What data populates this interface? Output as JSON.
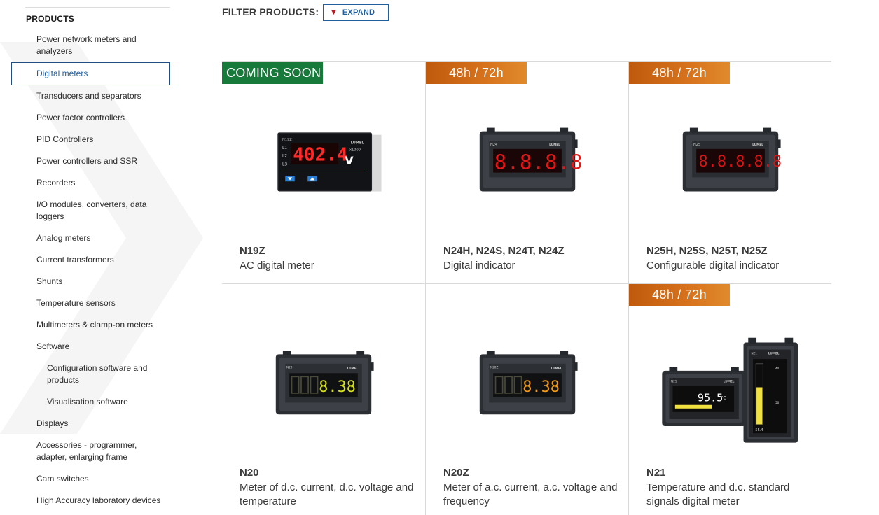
{
  "sidebar": {
    "heading": "PRODUCTS",
    "items": [
      {
        "label": "Power network meters and analyzers",
        "sub": false,
        "active": false
      },
      {
        "label": "Digital meters",
        "sub": false,
        "active": true
      },
      {
        "label": "Transducers and separators",
        "sub": false,
        "active": false
      },
      {
        "label": "Power factor controllers",
        "sub": false,
        "active": false
      },
      {
        "label": "PID Controllers",
        "sub": false,
        "active": false
      },
      {
        "label": "Power controllers and SSR",
        "sub": false,
        "active": false
      },
      {
        "label": "Recorders",
        "sub": false,
        "active": false
      },
      {
        "label": "I/O modules, converters, data loggers",
        "sub": false,
        "active": false
      },
      {
        "label": "Analog meters",
        "sub": false,
        "active": false
      },
      {
        "label": "Current transformers",
        "sub": false,
        "active": false
      },
      {
        "label": "Shunts",
        "sub": false,
        "active": false
      },
      {
        "label": "Temperature sensors",
        "sub": false,
        "active": false
      },
      {
        "label": "Multimeters & clamp-on meters",
        "sub": false,
        "active": false
      },
      {
        "label": "Software",
        "sub": false,
        "active": false
      },
      {
        "label": "Configuration software and products",
        "sub": true,
        "active": false
      },
      {
        "label": "Visualisation software",
        "sub": true,
        "active": false
      },
      {
        "label": "Displays",
        "sub": false,
        "active": false
      },
      {
        "label": "Accessories - programmer, adapter, enlarging frame",
        "sub": false,
        "active": false
      },
      {
        "label": "Cam switches",
        "sub": false,
        "active": false
      },
      {
        "label": "High Accuracy laboratory devices",
        "sub": false,
        "active": false
      }
    ]
  },
  "filter": {
    "label": "FILTER PRODUCTS:",
    "expand_label": "EXPAND",
    "expand_icon": "triangle-down-icon"
  },
  "colors": {
    "accent_blue": "#1f5f9e",
    "badge_green": "#177a3a",
    "badge_orange": "#d7731d",
    "expand_arrow": "#b01e23"
  },
  "products": [
    {
      "code": "N19Z",
      "desc": "AC digital meter",
      "badge": "COMING SOON",
      "badge_style": "green",
      "display_digits": "402.4",
      "display_color": "#ff2a2a",
      "panel_labels": [
        "N19Z",
        "L1",
        "L2",
        "L3",
        "LUMEL",
        "x1000",
        "V"
      ]
    },
    {
      "code": "N24H, N24S, N24T, N24Z",
      "desc": "Digital indicator",
      "badge": "48h / 72h",
      "badge_style": "orange",
      "display_digits": "8.8.8.8",
      "display_color": "#e01818",
      "panel_labels": [
        "N24",
        "LUMEL"
      ]
    },
    {
      "code": "N25H, N25S, N25T, N25Z",
      "desc": "Configurable digital indicator",
      "badge": "48h / 72h",
      "badge_style": "orange",
      "display_digits": "8.8.8.8.8",
      "display_color": "#d01818",
      "panel_labels": [
        "N25",
        "LUMEL"
      ]
    },
    {
      "code": "N20",
      "desc": "Meter of d.c. current, d.c. voltage and temperature",
      "badge": "",
      "badge_style": "none",
      "display_digits": "8.38",
      "display_color": "#d8e21a",
      "panel_labels": [
        "N20",
        "LUMEL",
        "kV"
      ]
    },
    {
      "code": "N20Z",
      "desc": "Meter of a.c. current, a.c. voltage and frequency",
      "badge": "",
      "badge_style": "none",
      "display_digits": "8.38",
      "display_color": "#f29a1a",
      "panel_labels": [
        "N20Z",
        "LUMEL",
        "kV"
      ]
    },
    {
      "code": "N21",
      "desc": "Temperature and d.c. standard signals digital meter",
      "badge": "48h / 72h",
      "badge_style": "orange",
      "display_digits": "95.5",
      "display_color": "#f0e040",
      "panel_labels": [
        "N21",
        "LUMEL",
        "°C",
        "N21",
        "LUMEL",
        "40",
        "50",
        "55.4"
      ]
    }
  ]
}
